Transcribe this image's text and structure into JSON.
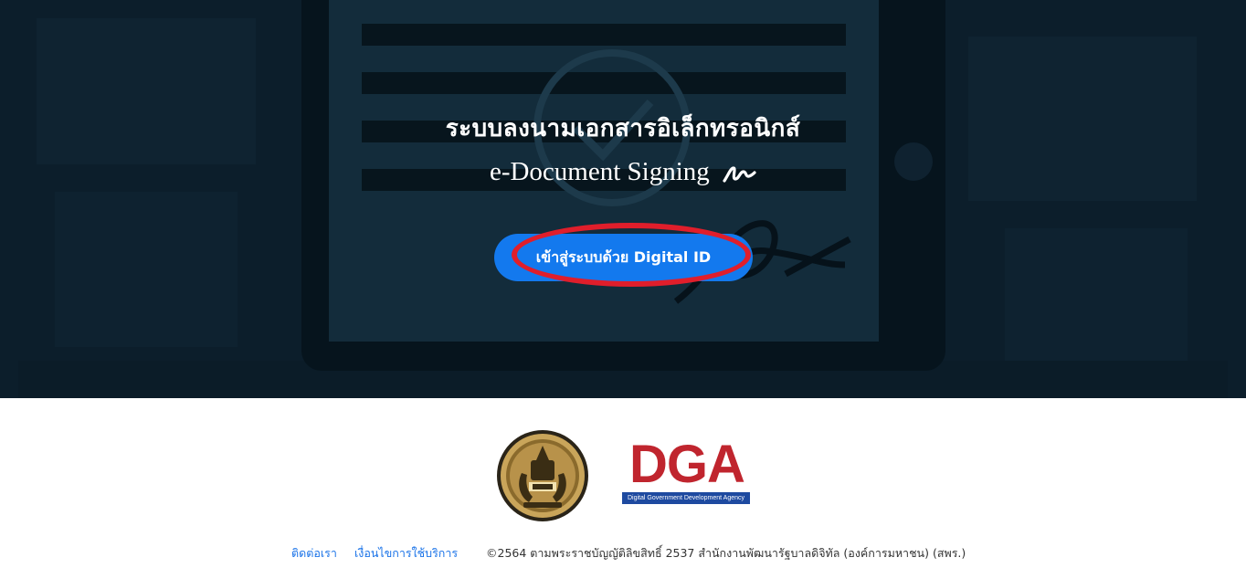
{
  "hero": {
    "title": "ระบบลงนามเอกสารอิเล็กทรอนิกส์",
    "subtitle": "e-Document Signing",
    "login_button_label": "เข้าสู่ระบบด้วย Digital ID",
    "highlight_color": "#e01e2b",
    "button_color": "#1379ee",
    "background_color": "#0c1e2b"
  },
  "footer": {
    "seal_logo": "thai-government-seal",
    "dga_logo_text": "DGA",
    "dga_logo_tagline": "Digital Government Development Agency",
    "dga_color": "#c0252e",
    "links": {
      "contact": "ติดต่อเรา",
      "terms": "เงื่อนไขการใช้บริการ"
    },
    "copyright": "©2564 ตามพระราชบัญญัติลิขสิทธิ์ 2537 สำนักงานพัฒนารัฐบาลดิจิทัล (องค์การมหาชน) (สพร.)"
  }
}
